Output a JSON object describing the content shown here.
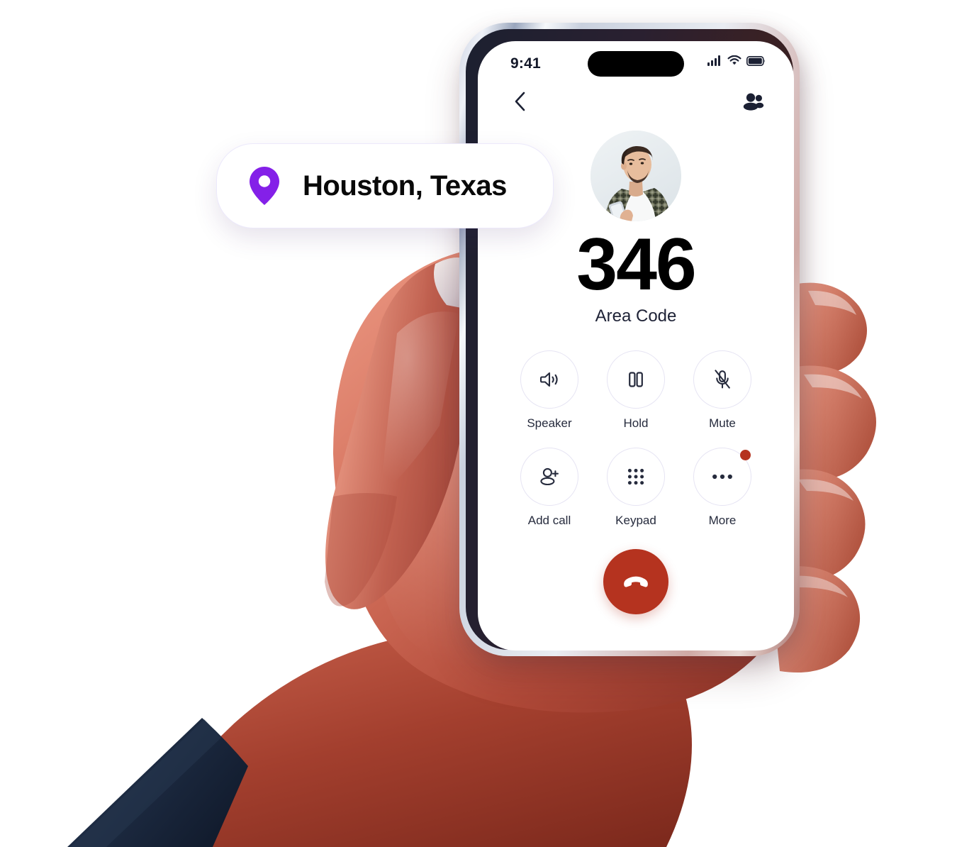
{
  "location_badge": {
    "icon": "map-pin-icon",
    "label": "Houston, Texas",
    "pin_color": "#8420e8"
  },
  "phone": {
    "status_bar": {
      "time": "9:41",
      "icons": [
        "cellular-signal-icon",
        "wifi-icon",
        "battery-icon"
      ]
    },
    "nav": {
      "back_icon": "chevron-left-icon",
      "contacts_icon": "contacts-people-icon"
    },
    "caller": {
      "avatar": "caller-avatar-photo",
      "number": "346",
      "label": "Area Code"
    },
    "actions": [
      {
        "id": "speaker",
        "label": "Speaker",
        "icon": "speaker-icon",
        "badge": false
      },
      {
        "id": "hold",
        "label": "Hold",
        "icon": "pause-icon",
        "badge": false
      },
      {
        "id": "mute",
        "label": "Mute",
        "icon": "mic-off-icon",
        "badge": false
      },
      {
        "id": "add-call",
        "label": "Add call",
        "icon": "person-plus-icon",
        "badge": false
      },
      {
        "id": "keypad",
        "label": "Keypad",
        "icon": "dial-grid-icon",
        "badge": false
      },
      {
        "id": "more",
        "label": "More",
        "icon": "ellipsis-icon",
        "badge": true
      }
    ],
    "end_call": {
      "icon": "phone-hangup-icon",
      "color": "#b5331f"
    }
  },
  "colors": {
    "accent_purple": "#8420e8",
    "end_call_red": "#b5331f",
    "icon_navy": "#262b3d",
    "circle_border": "#e6e4f3"
  }
}
